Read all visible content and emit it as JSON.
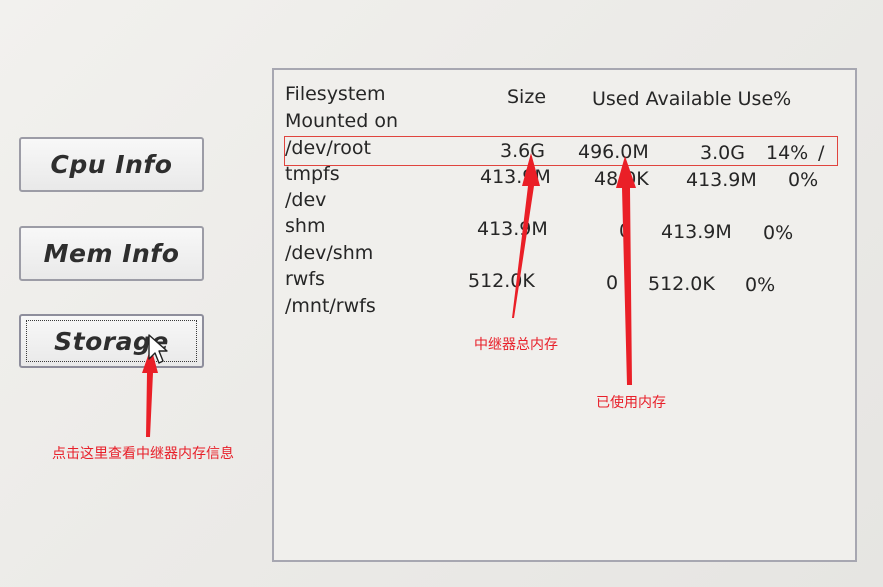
{
  "buttons": {
    "cpu": "Cpu Info",
    "mem": "Mem Info",
    "storage": "Storage"
  },
  "table": {
    "headers": {
      "filesystem": "Filesystem",
      "size": "Size",
      "used_available_use": "Used Available Use%",
      "mounted_on": "Mounted on"
    },
    "rows": [
      {
        "filesystem": "/dev/root",
        "size": "3.6G",
        "used": "496.0M",
        "available": "3.0G",
        "use_pct": "14%",
        "mounted_on": "/"
      },
      {
        "filesystem": "tmpfs",
        "size": "413.9M",
        "used": "48.0K",
        "available": "413.9M",
        "use_pct": "0%",
        "mounted_on": "/dev"
      },
      {
        "filesystem": "shm",
        "size": "413.9M",
        "used": "0",
        "available": "413.9M",
        "use_pct": "0%",
        "mounted_on": "/dev/shm"
      },
      {
        "filesystem": "rwfs",
        "size": "512.0K",
        "used": "0",
        "available": "512.0K",
        "use_pct": "0%",
        "mounted_on": "/mnt/rwfs"
      }
    ]
  },
  "annotations": {
    "total_memory": "中继器总内存",
    "used_memory": "已使用内存",
    "click_here": "点击这里查看中继器内存信息"
  },
  "colors": {
    "annotation": "#e8202a",
    "highlight_border": "#e0443e",
    "button_border": "#9c9ca6",
    "panel_border": "#a7a7b1"
  }
}
